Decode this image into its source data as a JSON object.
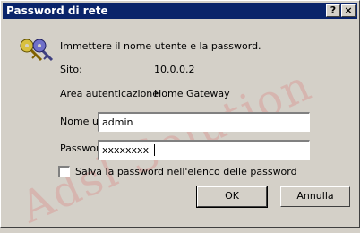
{
  "titlebar": {
    "title": "Password di rete",
    "help_label": "?",
    "close_label": "×"
  },
  "watermark": "Adsl Solution",
  "instruction": "Immettere il nome utente e la password.",
  "site": {
    "label": "Sito:",
    "value": "10.0.0.2"
  },
  "realm": {
    "label": "Area autenticazione",
    "value": "Home Gateway"
  },
  "username": {
    "label": "Nome utente",
    "value": "admin"
  },
  "password": {
    "label": "Password",
    "value": "xxxxxxxx"
  },
  "save_checkbox": {
    "label": "Salva la password nell'elenco delle password",
    "checked": false
  },
  "buttons": {
    "ok": "OK",
    "cancel": "Annulla"
  }
}
